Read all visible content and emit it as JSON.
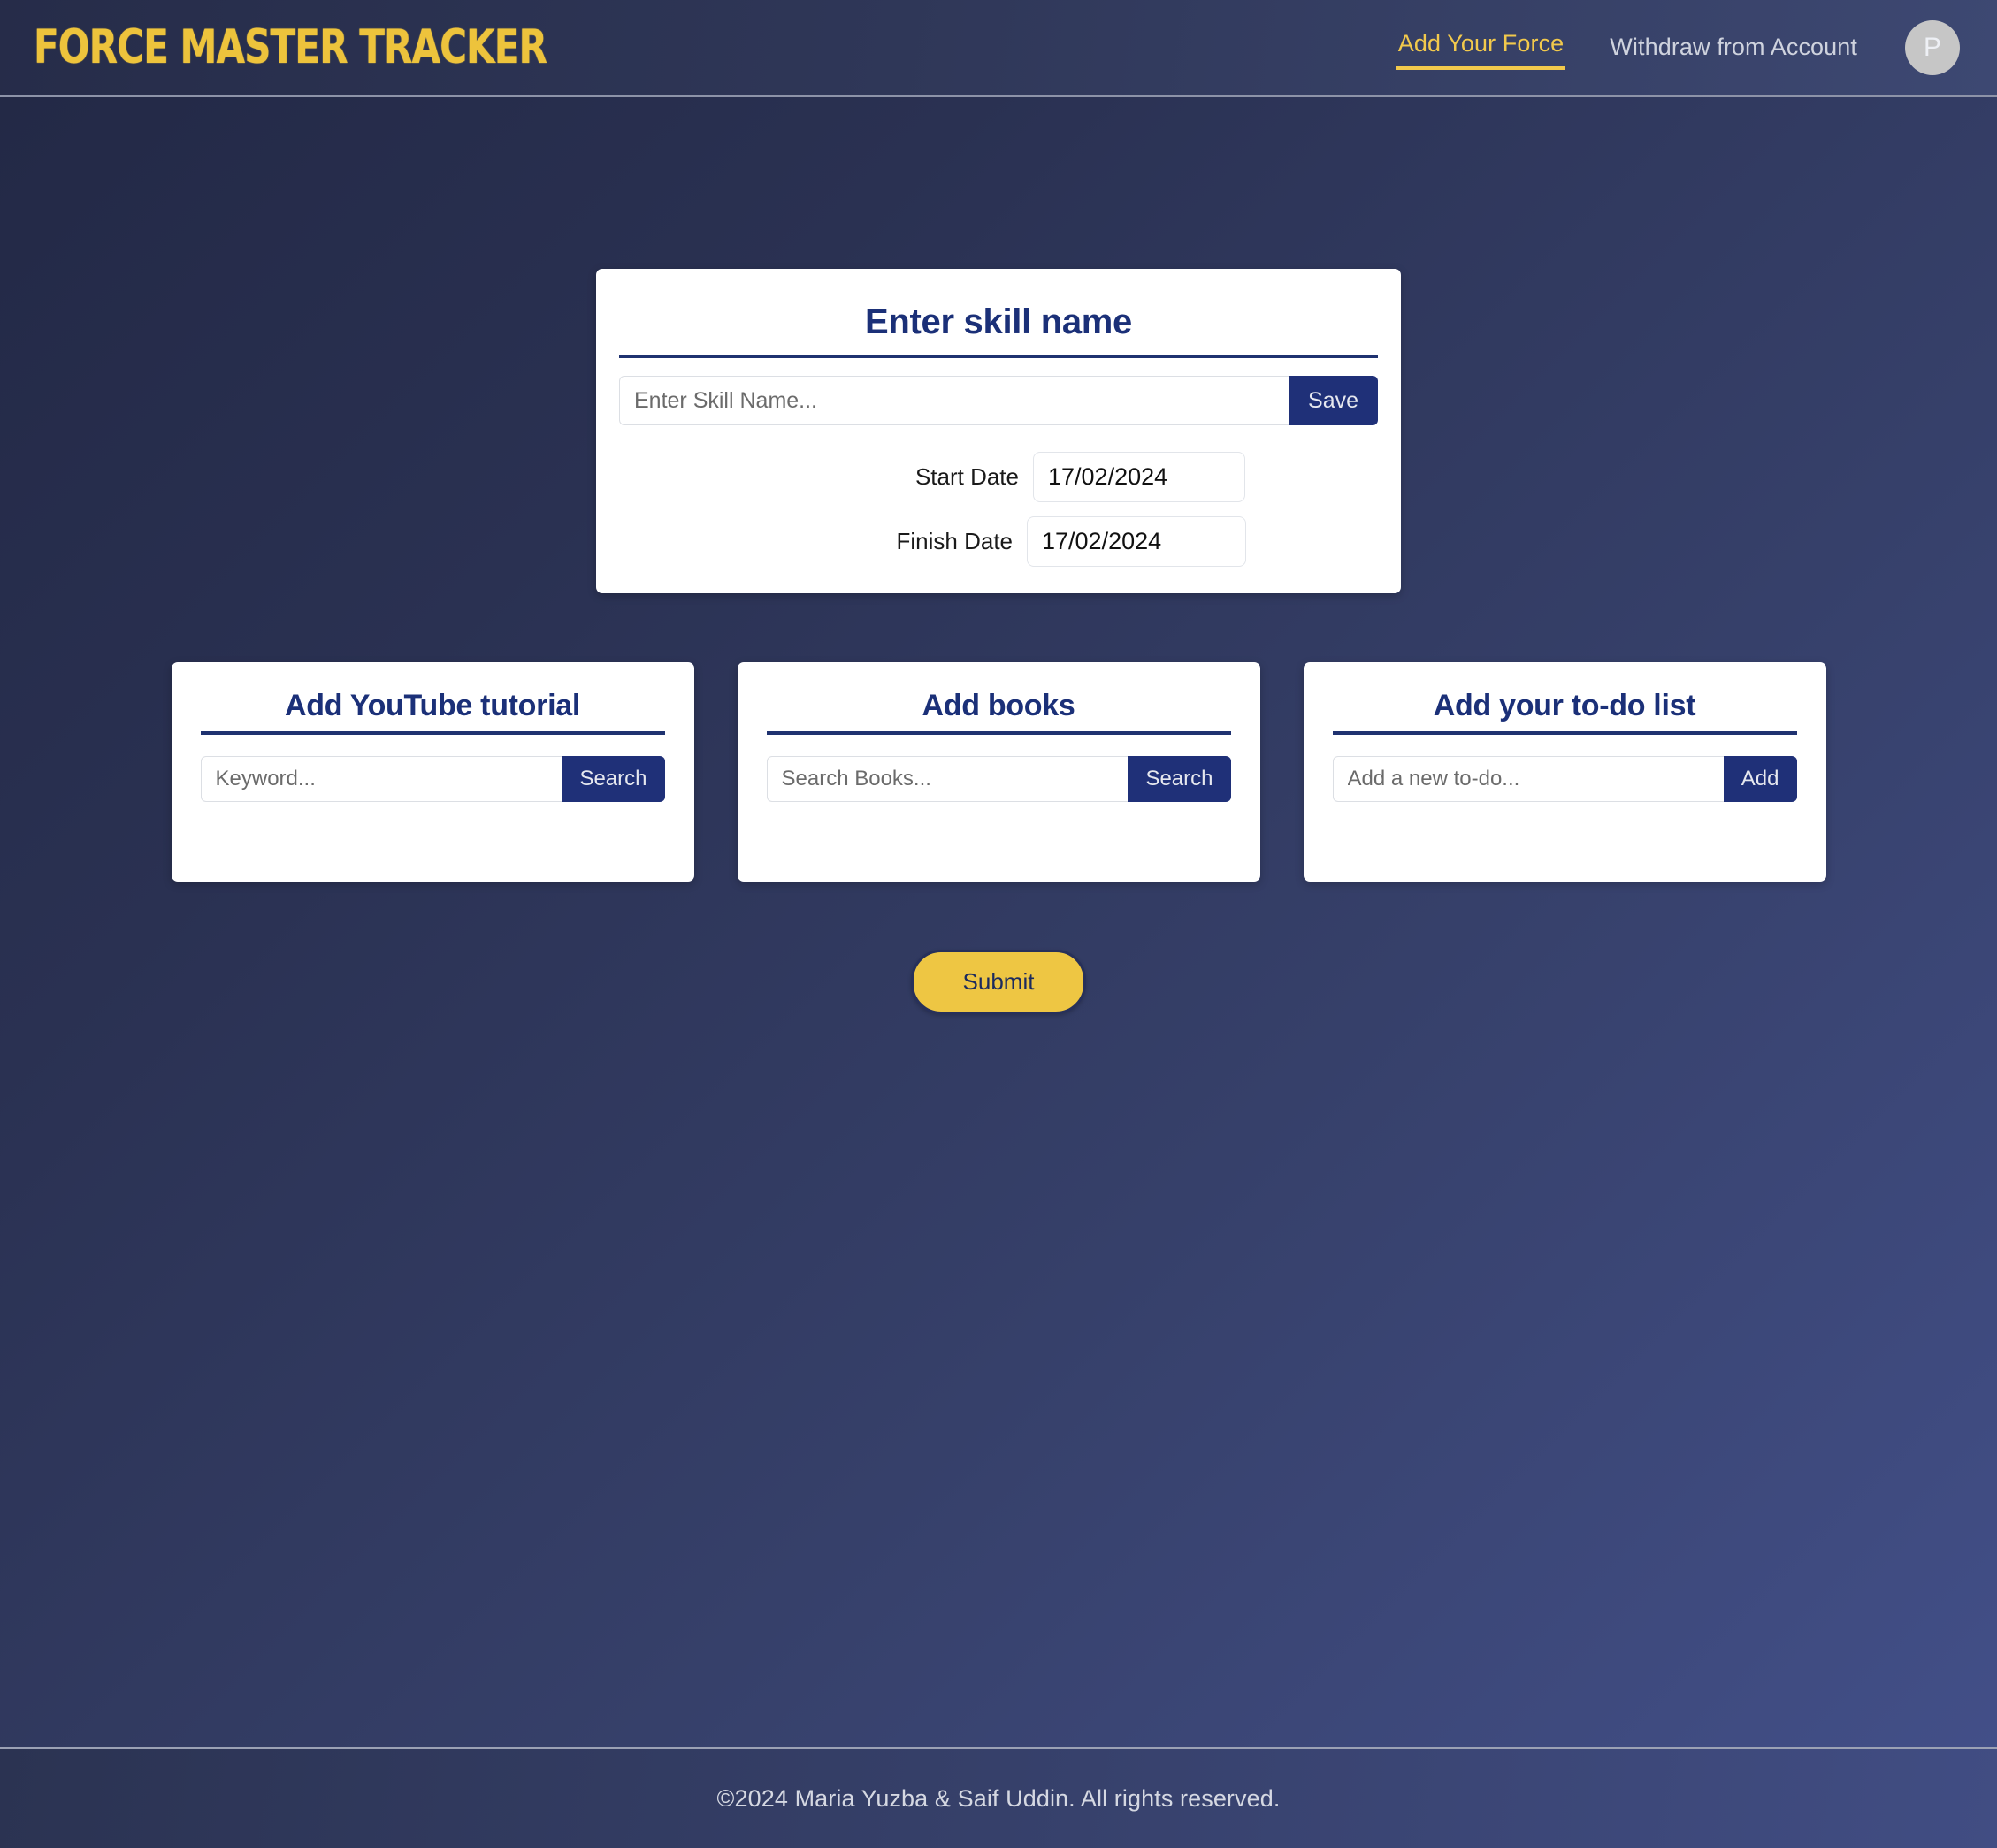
{
  "header": {
    "brand": "Force Master Tracker",
    "nav": [
      {
        "label": "Add Your Force",
        "state": "active"
      },
      {
        "label": "Withdraw from Account",
        "state": "inactive"
      }
    ],
    "avatar_initial": "P"
  },
  "skill_card": {
    "title": "Enter skill name",
    "skill_input_placeholder": "Enter Skill Name...",
    "skill_input_value": "",
    "save_label": "Save",
    "start_date_label": "Start Date",
    "start_date_value": "17/02/2024",
    "finish_date_label": "Finish Date",
    "finish_date_value": "17/02/2024"
  },
  "cards": [
    {
      "title": "Add YouTube tutorial",
      "placeholder": "Keyword...",
      "value": "",
      "button": "Search"
    },
    {
      "title": "Add books",
      "placeholder": "Search Books...",
      "value": "",
      "button": "Search"
    },
    {
      "title": "Add your to-do list",
      "placeholder": "Add a new to-do...",
      "value": "",
      "button": "Add"
    }
  ],
  "submit": {
    "label": "Submit"
  },
  "footer": {
    "text": "©2024 Maria Yuzba & Saif Uddin. All rights reserved."
  },
  "colors": {
    "brand_yellow": "#edc33c",
    "accent_navy": "#1f3078",
    "bg_dark": "#222845",
    "bg_light": "#43508a",
    "submit_yellow": "#eec643"
  }
}
